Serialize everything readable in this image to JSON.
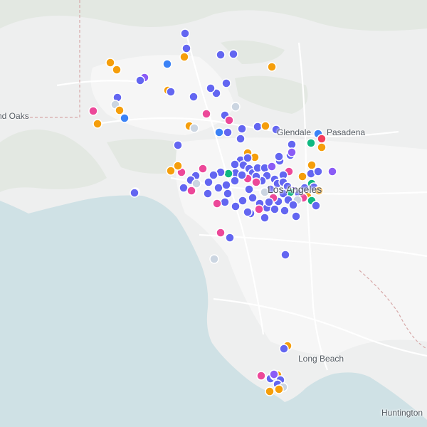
{
  "map": {
    "colors": {
      "land": "#eeefef",
      "water": "#cfe1e5",
      "park": "#e3e8e2",
      "urban": "#f6f6f6",
      "road": "#ffffff",
      "boundary": "#d7a9a9",
      "marker_stroke": "#ffffff"
    },
    "labels": {
      "thousand_oaks": "nd Oaks",
      "glendale": "Glendale",
      "pasadena": "Pasadena",
      "los_angeles": "Los Angeles",
      "long_beach": "Long Beach",
      "huntington": "Huntington"
    },
    "categories": {
      "a": {
        "color": "#6366f1",
        "icon": "circle-marker"
      },
      "b": {
        "color": "#f59e0b",
        "icon": "circle-marker"
      },
      "c": {
        "color": "#ec4899",
        "icon": "circle-marker"
      },
      "d": {
        "color": "#8b5cf6",
        "icon": "circle-marker"
      },
      "e": {
        "color": "#10b981",
        "icon": "circle-marker"
      },
      "f": {
        "color": "#3b82f6",
        "icon": "circle-marker"
      },
      "g": {
        "color": "#cbd5e1",
        "icon": "circle-marker"
      },
      "h": {
        "color": "#f43f5e",
        "icon": "circle-marker"
      }
    }
  }
}
